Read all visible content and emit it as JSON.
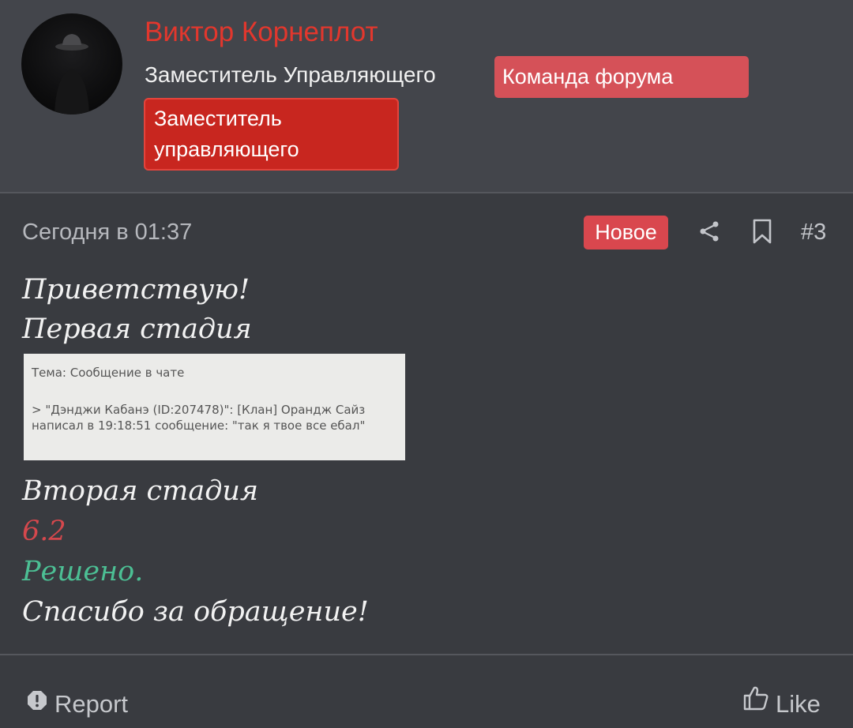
{
  "author": {
    "name": "Виктор Корнеплот",
    "title": "Заместитель Управляющего",
    "badges": [
      "Команда форума",
      "Заместитель управляющего"
    ]
  },
  "post": {
    "date": "Сегодня в 01:37",
    "new_label": "Новое",
    "number": "#3",
    "lines": {
      "greeting": "Приветствую!",
      "stage1": "Первая стадия",
      "stage2": "Вторая стадия",
      "rule": "6.2",
      "status": "Решено.",
      "thanks": "Спасибо за обращение!"
    },
    "attachment": {
      "subject": "Тема: Сообщение в чате",
      "message": "> \"Дэнджи Кабанэ (ID:207478)\": [Клан] Орандж Сайз написал в 19:18:51 сообщение: \"так я твое все ебал\""
    }
  },
  "footer": {
    "report_label": "Report",
    "like_label": "Like"
  },
  "icons": {
    "share": "share-icon",
    "bookmark": "bookmark-icon",
    "report": "report-icon",
    "like": "thumbs-up-icon"
  },
  "colors": {
    "username": "#e2372d",
    "team_badge": "#d55158",
    "role_badge": "#c8261f",
    "new_badge": "#d9474e",
    "rule_text": "#d5484d",
    "status_text": "#4cbf94",
    "background": "#393b40"
  }
}
